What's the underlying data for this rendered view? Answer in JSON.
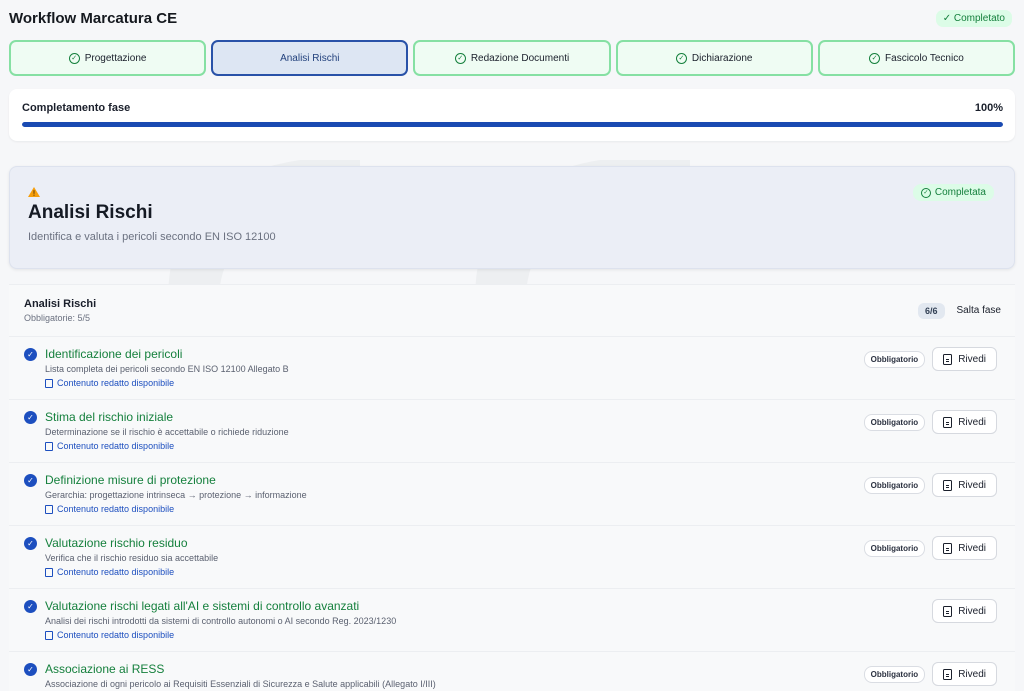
{
  "app": {
    "title": "Workflow Marcatura CE",
    "status_badge": "✓ Completato"
  },
  "steps": [
    {
      "label": "Progettazione",
      "done": true
    },
    {
      "label": "Analisi Rischi",
      "active": true
    },
    {
      "label": "Redazione Documenti",
      "done": true
    },
    {
      "label": "Dichiarazione",
      "done": true
    },
    {
      "label": "Fascicolo Tecnico",
      "done": true
    }
  ],
  "progress": {
    "label": "Completamento fase",
    "value_text": "100%",
    "value": 1.0
  },
  "phase": {
    "icon": "warning-icon",
    "title": "Analisi Rischi",
    "subtitle": "Identifica e valuta i pericoli secondo EN ISO 12100",
    "badge": "Completata"
  },
  "panel": {
    "title": "Analisi Rischi",
    "subtitle": "Obbligatorie: 5/5",
    "count": "6/6",
    "skip_label": "Salta fase"
  },
  "items": [
    {
      "title": "Identificazione dei pericoli",
      "desc": "Lista completa dei pericoli secondo EN ISO 12100 Allegato B",
      "link": "Contenuto redatto disponibile",
      "required": "Obbligatorio",
      "action": "Rivedi"
    },
    {
      "title": "Stima del rischio iniziale",
      "desc": "Determinazione se il rischio è accettabile o richiede riduzione",
      "link": "Contenuto redatto disponibile",
      "required": "Obbligatorio",
      "action": "Rivedi"
    },
    {
      "title": "Definizione misure di protezione",
      "desc": "Gerarchia: progettazione intrinseca → protezione → informazione",
      "link": "Contenuto redatto disponibile",
      "required": "Obbligatorio",
      "action": "Rivedi"
    },
    {
      "title": "Valutazione rischio residuo",
      "desc": "Verifica che il rischio residuo sia accettabile",
      "link": "Contenuto redatto disponibile",
      "required": "Obbligatorio",
      "action": "Rivedi"
    },
    {
      "title": "Valutazione rischi legati all'AI e sistemi di controllo avanzati",
      "desc": "Analisi dei rischi introdotti da sistemi di controllo autonomi o AI secondo Reg. 2023/1230",
      "link": "Contenuto redatto disponibile",
      "required": "",
      "action": "Rivedi"
    },
    {
      "title": "Associazione ai RESS",
      "desc": "Associazione di ogni pericolo ai Requisiti Essenziali di Sicurezza e Salute applicabili (Allegato I/III)",
      "link": "",
      "required": "Obbligatorio",
      "action": "Rivedi"
    }
  ],
  "colors": {
    "accent": "#1d4fbf",
    "success": "#15803d",
    "progress": "#1a4ab2"
  }
}
